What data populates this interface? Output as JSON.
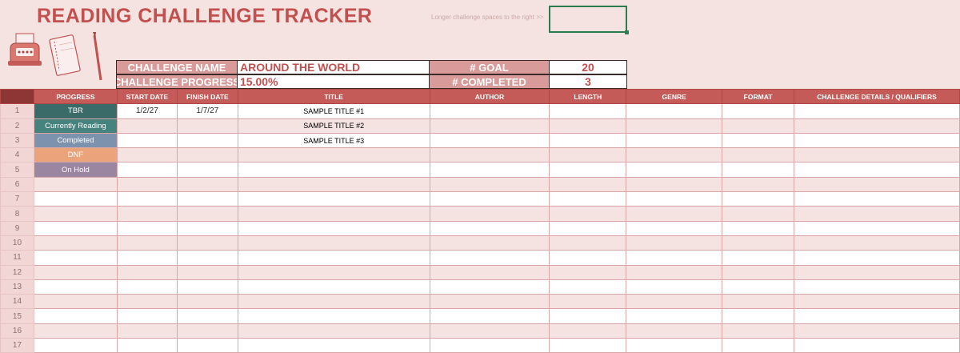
{
  "header": {
    "title": "READING CHALLENGE TRACKER",
    "note": "Longer challenge spaces to the right >>"
  },
  "challenge": {
    "name_label": "CHALLENGE NAME",
    "name_value": "AROUND THE WORLD",
    "progress_label": "CHALLENGE PROGRESS",
    "progress_value": "15.00%",
    "goal_label": "# GOAL",
    "goal_value": "20",
    "completed_label": "# COMPLETED",
    "completed_value": "3"
  },
  "columns": [
    "PROGRESS",
    "START DATE",
    "FINISH DATE",
    "TITLE",
    "AUTHOR",
    "LENGTH",
    "GENRE",
    "FORMAT",
    "CHALLENGE DETAILS / QUALIFIERS"
  ],
  "statuses": [
    {
      "label": "TBR",
      "color": "#3b6b68"
    },
    {
      "label": "Currently Reading",
      "color": "#46837e"
    },
    {
      "label": "Completed",
      "color": "#7d93ad"
    },
    {
      "label": "DNF",
      "color": "#eba37c"
    },
    {
      "label": "On Hold",
      "color": "#9a86a0"
    }
  ],
  "rows": [
    {
      "num": "1",
      "start": "1/2/27",
      "finish": "1/7/27",
      "title": "SAMPLE TITLE #1"
    },
    {
      "num": "2",
      "start": "",
      "finish": "",
      "title": "SAMPLE TITLE #2"
    },
    {
      "num": "3",
      "start": "",
      "finish": "",
      "title": "SAMPLE TITLE #3"
    },
    {
      "num": "4",
      "start": "",
      "finish": "",
      "title": ""
    },
    {
      "num": "5",
      "start": "",
      "finish": "",
      "title": ""
    },
    {
      "num": "6",
      "start": "",
      "finish": "",
      "title": ""
    },
    {
      "num": "7",
      "start": "",
      "finish": "",
      "title": ""
    },
    {
      "num": "8",
      "start": "",
      "finish": "",
      "title": ""
    },
    {
      "num": "9",
      "start": "",
      "finish": "",
      "title": ""
    },
    {
      "num": "10",
      "start": "",
      "finish": "",
      "title": ""
    },
    {
      "num": "11",
      "start": "",
      "finish": "",
      "title": ""
    },
    {
      "num": "12",
      "start": "",
      "finish": "",
      "title": ""
    },
    {
      "num": "13",
      "start": "",
      "finish": "",
      "title": ""
    },
    {
      "num": "14",
      "start": "",
      "finish": "",
      "title": ""
    },
    {
      "num": "15",
      "start": "",
      "finish": "",
      "title": ""
    },
    {
      "num": "16",
      "start": "",
      "finish": "",
      "title": ""
    },
    {
      "num": "17",
      "start": "",
      "finish": "",
      "title": ""
    }
  ],
  "illustration_icons": [
    "typewriter-icon",
    "notebook-icon",
    "fountain-pen-icon"
  ]
}
